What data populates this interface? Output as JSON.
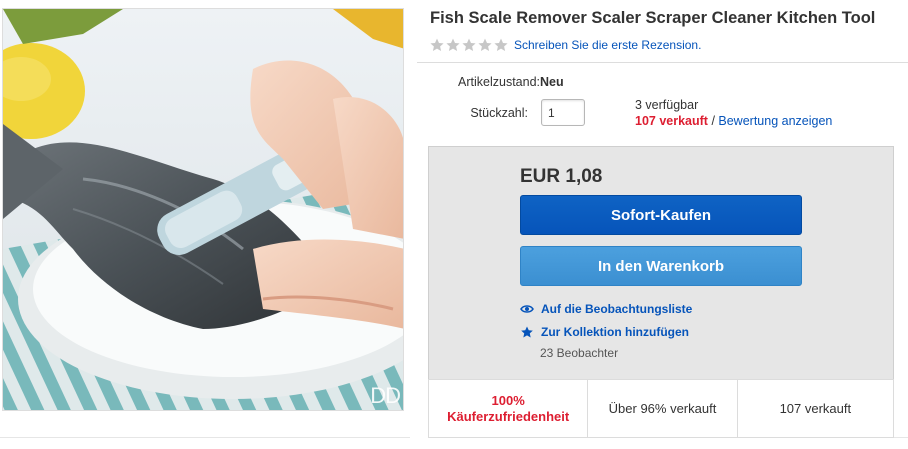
{
  "product": {
    "title": "Fish Scale Remover Scaler Scraper Cleaner Kitchen Tool",
    "review_link": "Schreiben Sie die erste Rezension.",
    "image_watermark": "DD"
  },
  "rating": {
    "value": 0,
    "max": 5
  },
  "details": {
    "condition_label": "Artikelzustand:",
    "condition_value": "Neu",
    "quantity_label": "Stückzahl:",
    "quantity_value": "1",
    "available": "3 verfügbar",
    "sold": "107 verkauft",
    "separator": " / ",
    "feedback_link": "Bewertung anzeigen"
  },
  "buybox": {
    "price": "EUR 1,08",
    "buy_now": "Sofort-Kaufen",
    "add_to_cart": "In den Warenkorb",
    "watch": "Auf die Beobachtungsliste",
    "collection": "Zur Kollektion hinzufügen",
    "watchers": "23 Beobachter",
    "stats": {
      "satisfaction_pct": "100%",
      "satisfaction_label": "Käuferzufriedenheit",
      "sold_pct": "Über 96% verkauft",
      "sold_count": "107 verkauft"
    }
  },
  "colors": {
    "link": "#0654ba",
    "primary_button": "#0654ba",
    "secondary_button": "#3b8fd1",
    "highlight_red": "#dd1e31",
    "star_empty": "#c7c7c7"
  },
  "icons": {
    "watch": "eye-icon",
    "collection": "star-icon",
    "rating": "star-icon"
  }
}
